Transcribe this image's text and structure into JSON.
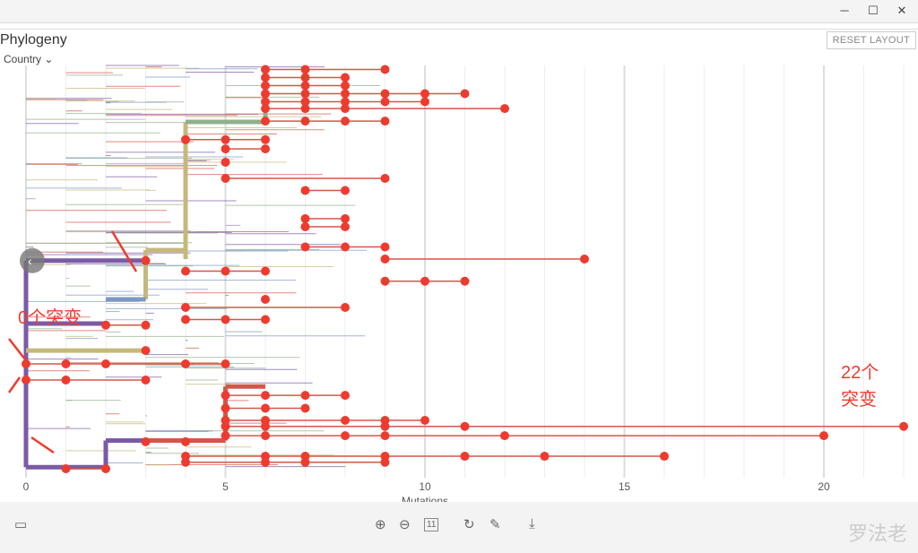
{
  "window": {
    "controls": [
      "─",
      "☐",
      "✕"
    ]
  },
  "panel": {
    "title": "Phylogeny",
    "color_by": "Country",
    "reset_label": "RESET LAYOUT"
  },
  "chart_data": {
    "type": "phylogenetic-tree",
    "xlabel": "Mutations",
    "xlim": [
      0,
      22
    ],
    "xticks": [
      "0",
      "5",
      "10",
      "15",
      "20"
    ],
    "grid": true,
    "colors": {
      "root": "#7b5aa6",
      "olive": "#c4b97a",
      "green": "#8fb08c",
      "red": "#d4564a",
      "tip": "#ee3b2f",
      "blue": "#7d98c4"
    },
    "backbone": [
      {
        "from": 0,
        "to": 3,
        "row": 48.4,
        "color": "root"
      },
      {
        "from": 3,
        "to": 4,
        "row": 45.8,
        "color": "olive"
      },
      {
        "from": 4,
        "to": 6,
        "row": 14,
        "color": "green"
      },
      {
        "from": 0,
        "to": 2,
        "row": 99.6,
        "color": "root"
      },
      {
        "from": 2,
        "to": 3,
        "row": 93,
        "color": "root"
      },
      {
        "from": 3,
        "to": 5,
        "row": 93,
        "color": "red"
      },
      {
        "from": 5,
        "to": 6,
        "row": 79.6,
        "color": "red"
      },
      {
        "from": 0,
        "to": 2,
        "row": 64,
        "color": "root"
      },
      {
        "from": 0,
        "to": 3,
        "row": 70.7,
        "color": "olive"
      },
      {
        "from": 2,
        "to": 3,
        "row": 58,
        "color": "blue"
      }
    ],
    "verticals": [
      {
        "mut": 0,
        "top": 48.4,
        "bottom": 99.6,
        "color": "root"
      },
      {
        "mut": 3,
        "top": 45.8,
        "bottom": 58,
        "color": "olive"
      },
      {
        "mut": 4,
        "top": 14,
        "bottom": 48,
        "color": "olive"
      },
      {
        "mut": 6,
        "top": 0,
        "bottom": 14,
        "color": "green"
      },
      {
        "mut": 2,
        "top": 93,
        "bottom": 99.6,
        "color": "root"
      },
      {
        "mut": 5,
        "top": 79.6,
        "bottom": 93,
        "color": "red"
      }
    ],
    "red_tips": [
      [
        1,
        [
          6,
          7,
          9
        ]
      ],
      [
        3,
        [
          6,
          7,
          8
        ]
      ],
      [
        5,
        [
          6,
          7,
          8
        ]
      ],
      [
        7,
        [
          6,
          7,
          8,
          9,
          10,
          11
        ]
      ],
      [
        9,
        [
          6,
          7,
          8,
          9,
          10
        ]
      ],
      [
        10.7,
        [
          6,
          7,
          8,
          12
        ]
      ],
      [
        13.8,
        [
          6,
          7,
          8,
          9
        ]
      ],
      [
        18.4,
        [
          4,
          5,
          6
        ]
      ],
      [
        20.7,
        [
          5,
          6
        ]
      ],
      [
        24,
        [
          5
        ]
      ],
      [
        28,
        [
          5,
          9
        ]
      ],
      [
        31,
        [
          7,
          8
        ]
      ],
      [
        38,
        [
          7,
          8
        ]
      ],
      [
        40,
        [
          7,
          8
        ]
      ],
      [
        45,
        [
          7,
          8,
          9
        ]
      ],
      [
        48,
        [
          9,
          14
        ]
      ],
      [
        48.4,
        [
          3
        ]
      ],
      [
        51,
        [
          4,
          5,
          6
        ]
      ],
      [
        53.5,
        [
          9,
          10,
          11
        ]
      ],
      [
        58,
        [
          6
        ]
      ],
      [
        60,
        [
          4,
          8
        ]
      ],
      [
        63,
        [
          4,
          5,
          6
        ]
      ],
      [
        64.4,
        [
          2,
          3
        ]
      ],
      [
        70.7,
        [
          3
        ]
      ],
      [
        74,
        [
          0,
          1,
          2,
          4,
          5
        ]
      ],
      [
        78,
        [
          0,
          1,
          3
        ]
      ],
      [
        81.8,
        [
          5,
          6,
          7,
          8
        ]
      ],
      [
        85,
        [
          5,
          6,
          7
        ]
      ],
      [
        88,
        [
          5,
          6,
          8,
          9,
          10
        ]
      ],
      [
        89.5,
        [
          5,
          6,
          9,
          11,
          22
        ]
      ],
      [
        91.8,
        [
          5,
          6,
          8,
          9,
          12,
          20
        ]
      ],
      [
        93.3,
        [
          3,
          4
        ]
      ],
      [
        96.9,
        [
          4,
          6,
          7,
          9,
          11,
          13,
          16
        ]
      ],
      [
        98.4,
        [
          4,
          6,
          7,
          9
        ]
      ],
      [
        100,
        [
          1,
          2
        ]
      ]
    ]
  },
  "annotations": {
    "zero": "0个突变",
    "twentytwo_a": "22个",
    "twentytwo_b": "突变"
  },
  "toolbar": {
    "layout": "▭",
    "zoom_in": "⊕",
    "zoom_out": "⊖",
    "fit": "11",
    "rotate": "↻",
    "edit": "✎",
    "download": "⤓"
  },
  "watermark": "罗法老"
}
